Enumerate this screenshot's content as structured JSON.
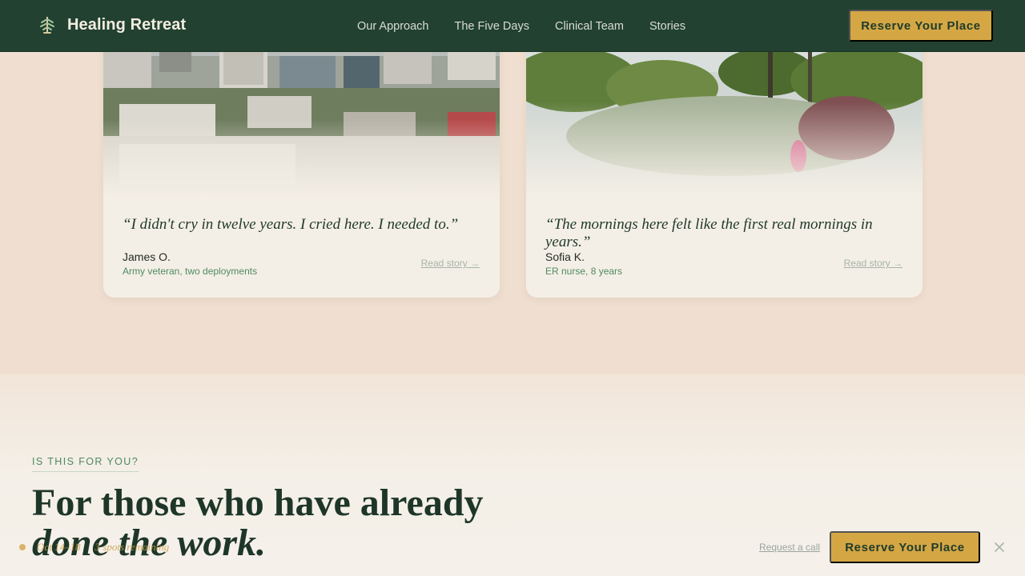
{
  "nav": {
    "brand": "Healing Retreat",
    "brand_icon": "tree-icon",
    "links": [
      "Our Approach",
      "The Five Days",
      "Clinical Team",
      "Stories"
    ],
    "cta": "Reserve Your Place"
  },
  "stories": [
    {
      "quote": "“I didn't cry in twelve years. I cried here. I needed to.”",
      "name": "James O.",
      "role": "Army veteran, two deployments",
      "link": "Read story →"
    },
    {
      "quote": "“The mornings here felt like the first real mornings in years.”",
      "name": "Sofia K.",
      "role": "ER nurse, 8 years",
      "link": "Read story →"
    }
  ],
  "who": {
    "eyebrow": "IS THIS FOR YOU?",
    "headline_line1": "For those who have already",
    "headline_line2": "done the work."
  },
  "sticky": {
    "date": "Oct 14–18",
    "spots": "3 spots remaining",
    "request": "Request a call",
    "cta": "Reserve Your Place"
  },
  "colors": {
    "nav_bg": "#224130",
    "accent": "#d4a744",
    "page_bg": "#f0dfd0",
    "heading": "#1e3628"
  }
}
